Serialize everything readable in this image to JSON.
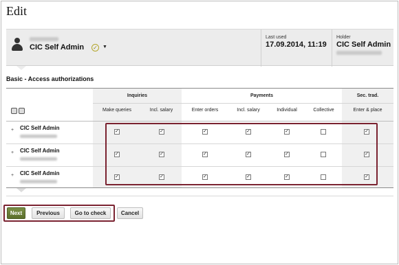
{
  "page": {
    "title": "Edit"
  },
  "header": {
    "user_name": "CIC Self Admin",
    "last_used_label": "Last used",
    "last_used_value": "17.09.2014, 11:19",
    "holder_label": "Holder",
    "holder_value": "CIC Self Admin"
  },
  "section": {
    "title": "Basic - Access authorizations"
  },
  "table": {
    "groups": [
      "Inquiries",
      "Payments",
      "Sec. trad."
    ],
    "columns": [
      "Make queries",
      "Incl. salary",
      "Enter orders",
      "Incl. salary",
      "Individual",
      "Collective",
      "Enter & place"
    ],
    "rows": [
      {
        "name": "CIC Self Admin",
        "checks": [
          true,
          true,
          true,
          true,
          true,
          false,
          true
        ]
      },
      {
        "name": "CIC Self Admin",
        "checks": [
          true,
          true,
          true,
          true,
          true,
          false,
          true
        ]
      },
      {
        "name": "CIC Self Admin",
        "checks": [
          true,
          true,
          true,
          true,
          true,
          false,
          true
        ]
      }
    ],
    "check_glyph": "☑",
    "empty_glyph": ""
  },
  "buttons": {
    "next": "Next",
    "previous": "Previous",
    "go_to_check": "Go to check",
    "cancel": "Cancel"
  },
  "icons": {
    "verified": "✓",
    "chevron_down": "▼",
    "expand": "+"
  },
  "colors": {
    "highlight": "#7a2230",
    "next_button": "#6b7f3a"
  }
}
